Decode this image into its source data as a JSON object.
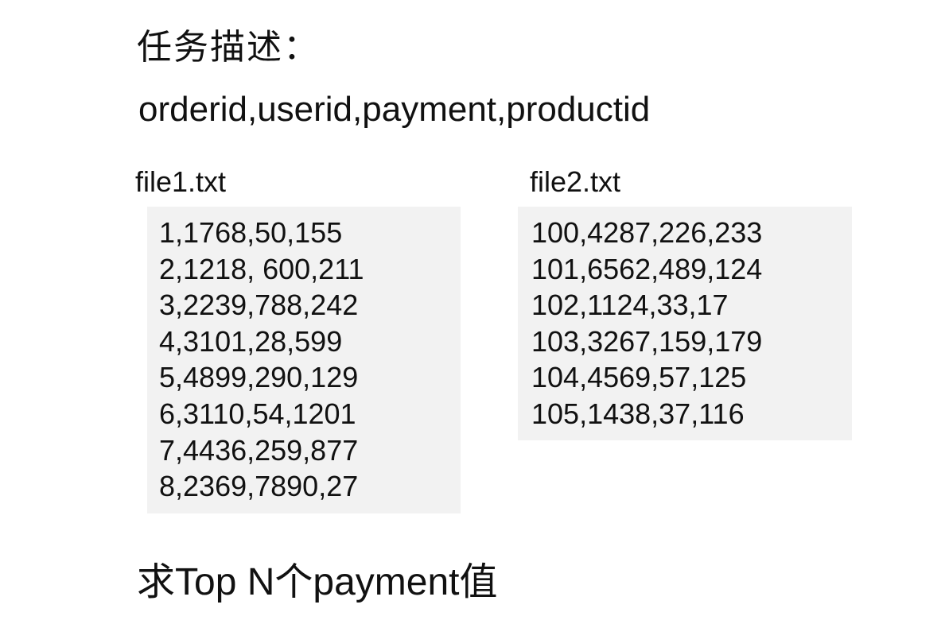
{
  "title": "任务描述：",
  "fields": "orderid,userid,payment,productid",
  "file1": {
    "name": "file1.txt",
    "rows": [
      "1,1768,50,155",
      "2,1218, 600,211",
      "3,2239,788,242",
      "4,3101,28,599",
      "5,4899,290,129",
      "6,3110,54,1201",
      "7,4436,259,877",
      "8,2369,7890,27"
    ]
  },
  "file2": {
    "name": "file2.txt",
    "rows": [
      "100,4287,226,233",
      "101,6562,489,124",
      "102,1124,33,17",
      "103,3267,159,179",
      "104,4569,57,125",
      "105,1438,37,116"
    ]
  },
  "question": "求Top N个payment值"
}
